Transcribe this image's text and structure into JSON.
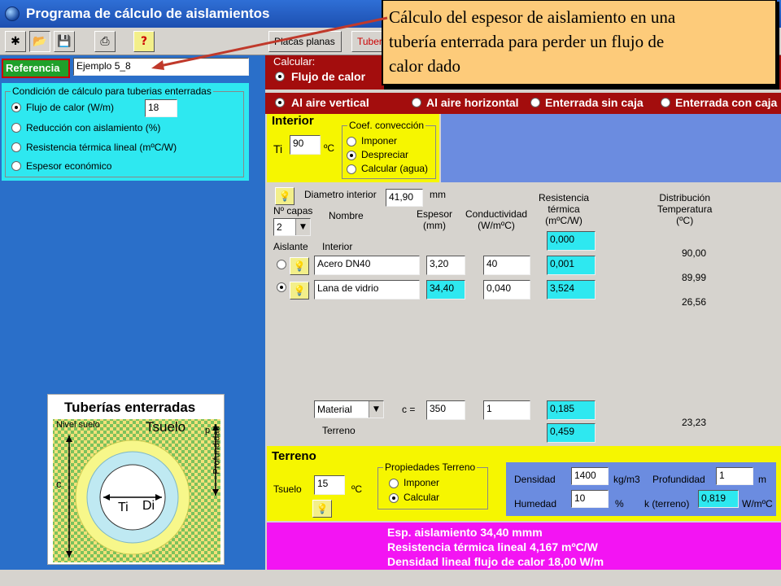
{
  "window": {
    "title": "Programa de cálculo de aislamientos"
  },
  "toolbar": {
    "tab1_label": "Placas planas",
    "tab2_label": "Tuberías"
  },
  "reference": {
    "label": "Referencia",
    "value": "Ejemplo 5_8"
  },
  "condition": {
    "group_label": "Condición de cálculo para tuberias enterradas",
    "options": [
      "Flujo de calor  (W/m)",
      "Reducción con aislamiento (%)",
      "Resistencia térmica lineal (mºC/W)",
      "Espesor económico"
    ],
    "selected": 0,
    "flow_value": "18"
  },
  "calculate": {
    "label": "Calcular:",
    "options": [
      "Flujo de calor",
      "Al aire vertical",
      "Al aire horizontal",
      "Enterrada sin caja",
      "Enterrada con caja"
    ]
  },
  "interior": {
    "title": "Interior",
    "ti_label": "Ti",
    "ti_value": "90",
    "ti_unit": "ºC",
    "conv_label": "Coef. convección",
    "conv_options": [
      "Imponer",
      "Despreciar",
      "Calcular (agua)"
    ],
    "conv_selected": 1
  },
  "layers": {
    "diam_label": "Diametro interior",
    "diam_value": "41,90",
    "diam_unit": "mm",
    "ncapas_label": "Nº capas",
    "ncapas_value": "2",
    "col_nombre": "Nombre",
    "col_espesor": "Espesor\n(mm)",
    "col_conductividad": "Conductividad\n(W/mºC)",
    "col_resistencia": "Resistencia\ntérmica\n(mºC/W)",
    "col_distribucion": "Distribución\nTemperatura\n(ºC)",
    "aislante_label": "Aislante",
    "interior_label": "Interior",
    "interior_resistance": "0,000",
    "temps": [
      "90,00",
      "89,99",
      "26,56",
      "23,23"
    ],
    "rows": [
      {
        "name": "Acero DN40",
        "thickness": "3,20",
        "conductivity": "40",
        "resistance": "0,001",
        "selected": false
      },
      {
        "name": "Lana de vidrio",
        "thickness": "34,40",
        "conductivity": "0,040",
        "resistance": "3,524",
        "selected": true
      }
    ],
    "material": {
      "value": "Material",
      "c_label": "c =",
      "c_value": "350",
      "k_value": "1",
      "resistance": "0,185"
    },
    "terreno_label": "Terreno",
    "terreno_resistance": "0,459"
  },
  "diagram": {
    "title": "Tuberías enterradas",
    "nivel_suelo": "Nivel suelo",
    "tsuelo": "Tsuelo",
    "profundidad": "Profundidad",
    "p": "p",
    "c": "c",
    "ti": "Ti",
    "di": "Di"
  },
  "terreno": {
    "title": "Terreno",
    "tsuelo_label": "Tsuelo",
    "tsuelo_value": "15",
    "tsuelo_unit": "ºC",
    "prop_label": "Propiedades Terreno",
    "prop_options": [
      "Imponer",
      "Calcular"
    ],
    "prop_selected": 1,
    "densidad_label": "Densidad",
    "densidad_value": "1400",
    "densidad_unit": "kg/m3",
    "profundidad_label": "Profundidad",
    "profundidad_value": "1",
    "profundidad_unit": "m",
    "humedad_label": "Humedad",
    "humedad_value": "10",
    "humedad_unit": "%",
    "k_label": "k (terreno)",
    "k_value": "0,819",
    "k_unit": "W/mºC"
  },
  "results": [
    "Esp. aislamiento 34,40 mmm",
    "Resistencia térmica lineal 4,167 mºC/W",
    "Densidad lineal flujo de calor 18,00 W/m"
  ],
  "callout": {
    "text_lines": [
      "Cálculo del espesor de aislamiento en una",
      "tubería enterrada para perder un flujo de",
      "calor dado"
    ]
  },
  "colors": {
    "cyan": "#2ee8f0",
    "yellow": "#f6f600",
    "magenta": "#f314f3",
    "dark_red": "#a30d0d",
    "callout": "#fdcb7a"
  }
}
